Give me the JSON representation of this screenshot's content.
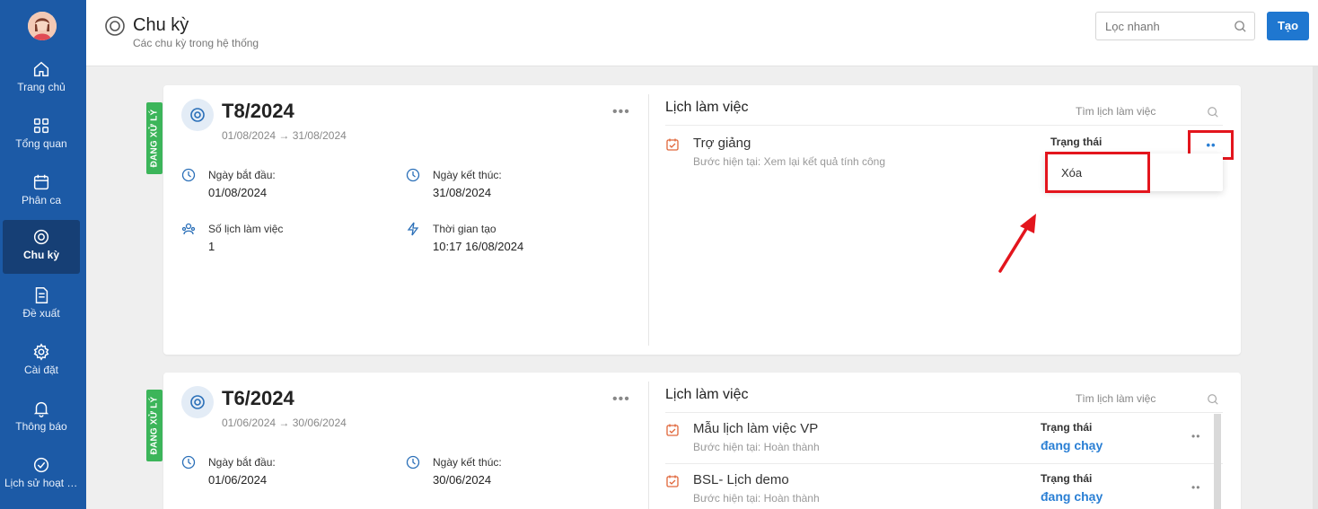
{
  "sidebar": {
    "items": [
      {
        "label": "Trang chủ",
        "icon": "home-icon"
      },
      {
        "label": "Tổng quan",
        "icon": "grid-icon"
      },
      {
        "label": "Phân ca",
        "icon": "calendar-icon"
      },
      {
        "label": "Chu kỳ",
        "icon": "cycle-icon",
        "active": true
      },
      {
        "label": "Đề xuất",
        "icon": "document-icon"
      },
      {
        "label": "Cài đặt",
        "icon": "gear-icon"
      },
      {
        "label": "Thông báo",
        "icon": "bell-icon"
      },
      {
        "label": "Lịch sử hoạt đ...",
        "icon": "check-circle-icon"
      }
    ]
  },
  "header": {
    "title": "Chu kỳ",
    "subtitle": "Các chu kỳ trong hệ thống",
    "search_placeholder": "Lọc nhanh",
    "create_label": "Tạo"
  },
  "cycles": [
    {
      "status": "ĐANG XỬ LÝ",
      "name": "T8/2024",
      "range_start": "01/08/2024",
      "range_end": "31/08/2024",
      "start_label": "Ngày bắt đầu:",
      "start_value": "01/08/2024",
      "end_label": "Ngày kết thúc:",
      "end_value": "31/08/2024",
      "count_label": "Số lịch làm việc",
      "count_value": "1",
      "created_label": "Thời gian tạo",
      "created_value": "10:17 16/08/2024",
      "schedule_title": "Lịch làm việc",
      "schedule_search": "Tìm lịch làm việc",
      "schedules": [
        {
          "name": "Trợ giảng",
          "step": "Bước hiện tại: Xem lại kết quả tính công",
          "status_label": "Trạng thái",
          "status_value": ""
        }
      ],
      "menu": {
        "delete_label": "Xóa"
      }
    },
    {
      "status": "ĐANG XỬ LÝ",
      "name": "T6/2024",
      "range_start": "01/06/2024",
      "range_end": "30/06/2024",
      "start_label": "Ngày bắt đầu:",
      "start_value": "01/06/2024",
      "end_label": "Ngày kết thúc:",
      "end_value": "30/06/2024",
      "schedule_title": "Lịch làm việc",
      "schedule_search": "Tìm lịch làm việc",
      "schedules": [
        {
          "name": "Mẫu lịch làm việc VP",
          "step": "Bước hiện tại: Hoàn thành",
          "status_label": "Trạng thái",
          "status_value": "đang chạy"
        },
        {
          "name": "BSL- Lịch demo",
          "step": "Bước hiện tại: Hoàn thành",
          "status_label": "Trạng thái",
          "status_value": "đang chạy"
        }
      ]
    }
  ],
  "colors": {
    "sidebar": "#1c5aa6",
    "accent": "#1f77d0",
    "status_tag": "#3cb55a",
    "highlight": "#e3151d"
  }
}
